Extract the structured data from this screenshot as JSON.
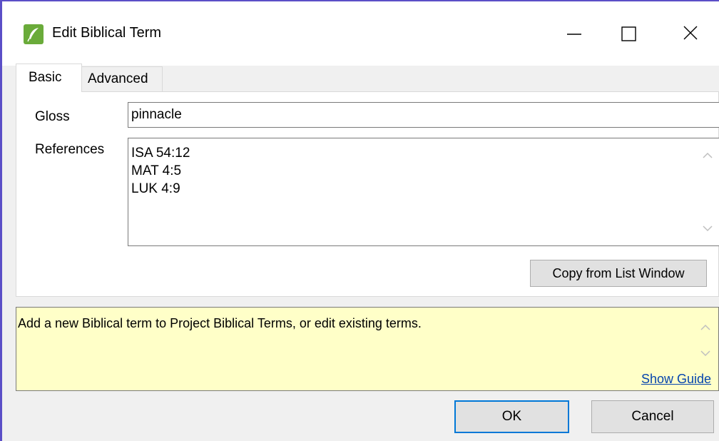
{
  "window": {
    "title": "Edit Biblical Term",
    "app_icon": "quill-icon",
    "controls": [
      "minimize-icon",
      "maximize-icon",
      "close-icon"
    ]
  },
  "tabs": [
    {
      "label": "Basic",
      "selected": true
    },
    {
      "label": "Advanced",
      "selected": false
    }
  ],
  "form": {
    "gloss_label": "Gloss",
    "gloss_value": "pinnacle",
    "references_label": "References",
    "references": [
      "ISA 54:12",
      "MAT 4:5",
      "LUK 4:9"
    ],
    "copy_button": "Copy from List Window"
  },
  "help": {
    "text": "Add a new Biblical term to Project Biblical Terms, or edit existing terms.",
    "link": "Show Guide"
  },
  "buttons": {
    "ok": "OK",
    "cancel": "Cancel"
  },
  "colors": {
    "accent_border": "#5b4fc7",
    "help_background": "#ffffc8",
    "link": "#0645ad",
    "default_button_border": "#0078d7"
  }
}
